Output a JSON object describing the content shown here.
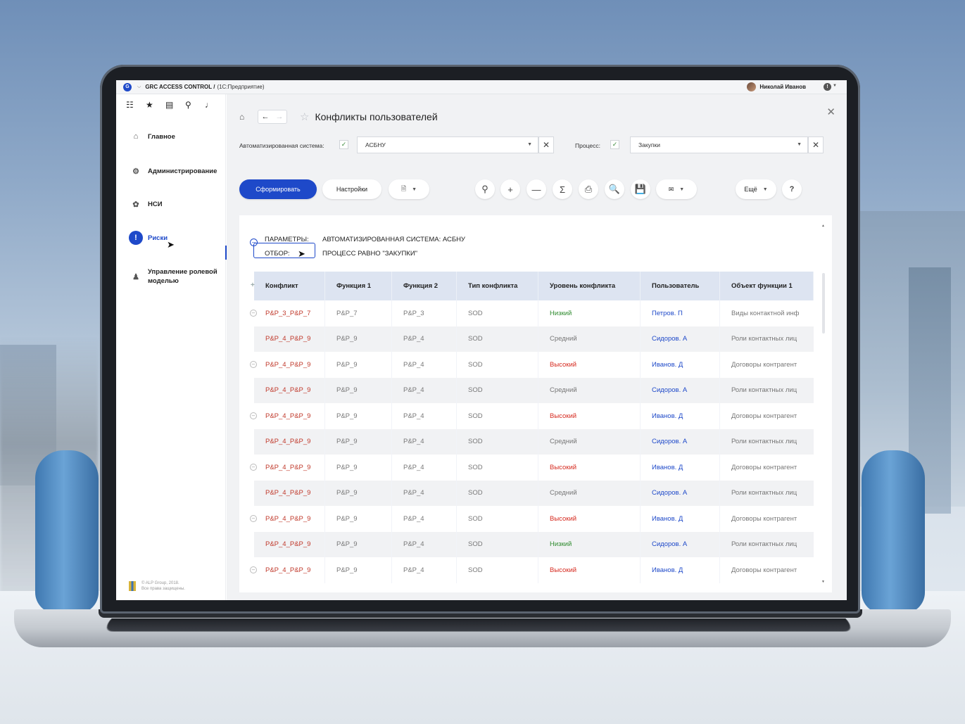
{
  "titlebar": {
    "app_logo": "G",
    "title": "GRC ACCESS CONTROL /",
    "subtitle": "(1С:Предприятие)",
    "user_name": "Николай Иванов"
  },
  "sidebar": {
    "items": [
      {
        "label": "Главное",
        "icon": "home-icon"
      },
      {
        "label": "Администрирование",
        "icon": "gear-icon"
      },
      {
        "label": "НСИ",
        "icon": "gears-icon"
      },
      {
        "label": "Риски",
        "icon": "exclamation-icon"
      },
      {
        "label": "Управление ролевой моделью",
        "icon": "person-icon"
      }
    ],
    "footer_line1": "© ALP Group, 2018.",
    "footer_line2": "Все права защищены."
  },
  "header": {
    "title": "Конфликты пользователей"
  },
  "filters": {
    "system_label": "Автоматизированная система:",
    "system_value": "АСБНУ",
    "process_label": "Процесс:",
    "process_value": "Закупки"
  },
  "toolbar": {
    "generate_label": "Сформировать",
    "settings_label": "Настройки",
    "more_label": "Ещё",
    "help_label": "?"
  },
  "report": {
    "params_key": "ПАРАМЕТРЫ:",
    "params_value": "АВТОМАТИЗИРОВАННАЯ СИСТЕМА: АСБНУ",
    "filter_key": "ОТБОР:",
    "filter_value": "ПРОЦЕСС РАВНО \"ЗАКУПКИ\""
  },
  "table": {
    "headers": [
      "Конфликт",
      "Функция 1",
      "Функция 2",
      "Тип конфликта",
      "Уровень конфликта",
      "Пользователь",
      "Объект функции 1"
    ],
    "rows": [
      {
        "conflict": "P&P_3_P&P_7",
        "f1": "P&P_7",
        "f2": "P&P_3",
        "type": "SOD",
        "level": "Низкий",
        "user": "Петров. П",
        "object": "Виды контактной инф",
        "group": true
      },
      {
        "conflict": "P&P_4_P&P_9",
        "f1": "P&P_9",
        "f2": "P&P_4",
        "type": "SOD",
        "level": "Средний",
        "user": "Сидоров. А",
        "object": "Роли контактных лиц",
        "group": false
      },
      {
        "conflict": "P&P_4_P&P_9",
        "f1": "P&P_9",
        "f2": "P&P_4",
        "type": "SOD",
        "level": "Высокий",
        "user": "Иванов. Д",
        "object": "Договоры контрагент",
        "group": true
      },
      {
        "conflict": "P&P_4_P&P_9",
        "f1": "P&P_9",
        "f2": "P&P_4",
        "type": "SOD",
        "level": "Средний",
        "user": "Сидоров. А",
        "object": "Роли контактных лиц",
        "group": false
      },
      {
        "conflict": "P&P_4_P&P_9",
        "f1": "P&P_9",
        "f2": "P&P_4",
        "type": "SOD",
        "level": "Высокий",
        "user": "Иванов. Д",
        "object": "Договоры контрагент",
        "group": true
      },
      {
        "conflict": "P&P_4_P&P_9",
        "f1": "P&P_9",
        "f2": "P&P_4",
        "type": "SOD",
        "level": "Средний",
        "user": "Сидоров. А",
        "object": "Роли контактных лиц",
        "group": false
      },
      {
        "conflict": "P&P_4_P&P_9",
        "f1": "P&P_9",
        "f2": "P&P_4",
        "type": "SOD",
        "level": "Высокий",
        "user": "Иванов. Д",
        "object": "Договоры контрагент",
        "group": true
      },
      {
        "conflict": "P&P_4_P&P_9",
        "f1": "P&P_9",
        "f2": "P&P_4",
        "type": "SOD",
        "level": "Средний",
        "user": "Сидоров. А",
        "object": "Роли контактных лиц",
        "group": false
      },
      {
        "conflict": "P&P_4_P&P_9",
        "f1": "P&P_9",
        "f2": "P&P_4",
        "type": "SOD",
        "level": "Высокий",
        "user": "Иванов. Д",
        "object": "Договоры контрагент",
        "group": true
      },
      {
        "conflict": "P&P_4_P&P_9",
        "f1": "P&P_9",
        "f2": "P&P_4",
        "type": "SOD",
        "level": "Низкий",
        "user": "Сидоров. А",
        "object": "Роли контактных лиц",
        "group": false
      },
      {
        "conflict": "P&P_4_P&P_9",
        "f1": "P&P_9",
        "f2": "P&P_4",
        "type": "SOD",
        "level": "Высокий",
        "user": "Иванов. Д",
        "object": "Договоры контрагент",
        "group": true
      }
    ]
  },
  "colors": {
    "accent": "#1e49c9",
    "conflict_text": "#c0392b",
    "level_low": "#2e8b2e",
    "level_high": "#d62b20",
    "header_bg": "#dde4f1"
  }
}
